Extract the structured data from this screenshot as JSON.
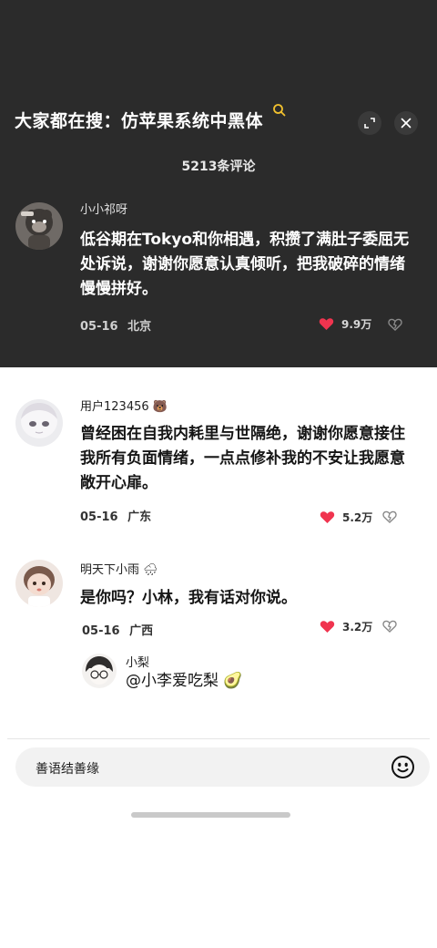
{
  "search": {
    "title": "大家都在搜：仿苹果系统中黑体",
    "search_icon": "search-icon",
    "expand_icon": "expand-icon",
    "close_icon": "close-icon"
  },
  "comments_header": {
    "count_text": "5213条评论"
  },
  "comments": [
    {
      "author": "小小祁呀",
      "text": "低谷期在Tokyo和你相遇，积攒了满肚子委屈无处诉说，谢谢你愿意认真倾听，把我破碎的情绪慢慢拼好。",
      "date": "05-16",
      "location": "北京",
      "likes": "9.9万"
    },
    {
      "author": "用户123456 🐻",
      "text": "曾经困在自我内耗里与世隔绝，谢谢你愿意接住我所有负面情绪，一点点修补我的不安让我愿意敞开心扉。",
      "date": "05-16",
      "location": "广东",
      "likes": "5.2万"
    },
    {
      "author": "明天下小雨 🌧",
      "text": "是你吗？小林，我有话对你说。",
      "date": "05-16",
      "location": "广西",
      "likes": "3.2万"
    }
  ],
  "reply": {
    "author": "小梨",
    "text": "@小李爱吃梨 🥑"
  },
  "input": {
    "placeholder": "善语结善缘",
    "emoji_icon": "smiley-icon"
  },
  "colors": {
    "dark_background": "#2b2b2b",
    "like_red": "#f0344f",
    "search_accent": "#f2c12e"
  }
}
